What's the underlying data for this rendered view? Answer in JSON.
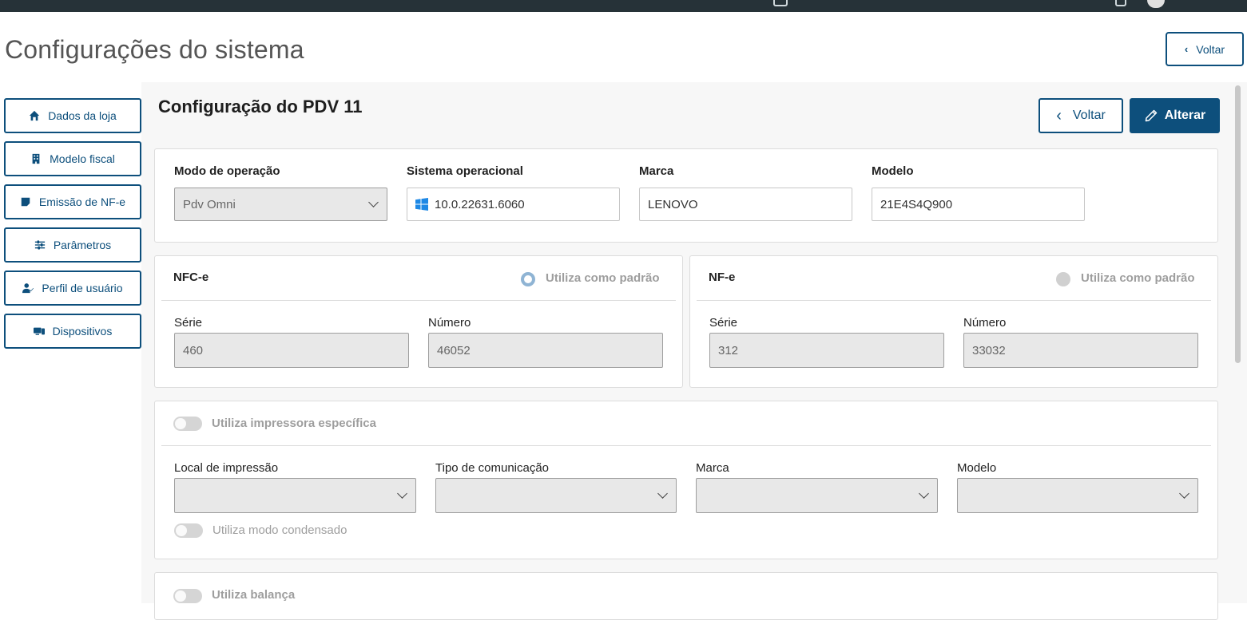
{
  "page": {
    "title": "Configurações do sistema",
    "back_label": "Voltar"
  },
  "sidebar": {
    "items": [
      {
        "label": "Dados da loja",
        "icon": "home-icon"
      },
      {
        "label": "Modelo fiscal",
        "icon": "building-icon"
      },
      {
        "label": "Emissão de NF-e",
        "icon": "note-icon"
      },
      {
        "label": "Parâmetros",
        "icon": "sliders-icon"
      },
      {
        "label": "Perfil de usuário",
        "icon": "user-check-icon"
      },
      {
        "label": "Dispositivos",
        "icon": "devices-icon"
      }
    ]
  },
  "section": {
    "title": "Configuração do PDV 11",
    "back_label": "Voltar",
    "edit_label": "Alterar"
  },
  "pdv": {
    "modo_label": "Modo de operação",
    "modo_value": "Pdv Omni",
    "so_label": "Sistema operacional",
    "so_value": "10.0.22631.6060",
    "marca_label": "Marca",
    "marca_value": "LENOVO",
    "modelo_label": "Modelo",
    "modelo_value": "21E4S4Q900"
  },
  "nfce": {
    "title": "NFC-e",
    "default_label": "Utiliza como padrão",
    "serie_label": "Série",
    "serie_value": "460",
    "numero_label": "Número",
    "numero_value": "46052"
  },
  "nfe": {
    "title": "NF-e",
    "default_label": "Utiliza como padrão",
    "serie_label": "Série",
    "serie_value": "312",
    "numero_label": "Número",
    "numero_value": "33032"
  },
  "printer": {
    "toggle_label": "Utiliza impressora específica",
    "local_label": "Local de impressão",
    "tipo_label": "Tipo de comunicação",
    "marca_label": "Marca",
    "modelo_label": "Modelo",
    "condensed_label": "Utiliza modo condensado"
  },
  "scale": {
    "toggle_label": "Utiliza balança"
  },
  "colors": {
    "primary": "#0d4f7c",
    "disabled_bg": "#e8e8e8",
    "muted_text": "#9e9e9e"
  }
}
